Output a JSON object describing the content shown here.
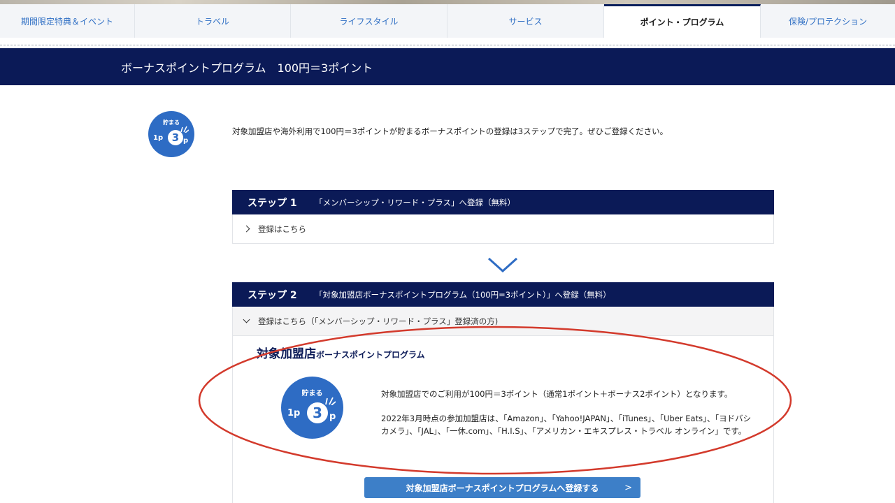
{
  "tabs": [
    {
      "label": "期間限定特典＆イベント",
      "active": false
    },
    {
      "label": "トラベル",
      "active": false
    },
    {
      "label": "ライフスタイル",
      "active": false
    },
    {
      "label": "サービス",
      "active": false
    },
    {
      "label": "ポイント・プログラム",
      "active": true
    },
    {
      "label": "保険/プロテクション",
      "active": false
    }
  ],
  "banner": {
    "title": "ボーナスポイントプログラム　100円＝3ポイント"
  },
  "badge": {
    "top": "貯まる",
    "one": "1p",
    "three": "3",
    "p": "p"
  },
  "intro": "対象加盟店や海外利用で100円＝3ポイントが貯まるボーナスポイントの登録は3ステップで完了。ぜひご登録ください。",
  "step1": {
    "num": "ステップ 1",
    "desc": "「メンバーシップ・リワード・プラス」へ登録（無料）",
    "link": "登録はこちら"
  },
  "step2": {
    "num": "ステップ 2",
    "desc": "「対象加盟店ボーナスポイントプログラム（100円=3ポイント）」へ登録（無料）",
    "link": "登録はこちら（「メンバーシップ・リワード・プラス」登録済の方)"
  },
  "panel": {
    "title_big": "対象加盟店",
    "title_small": "ボーナスポイントプログラム",
    "text1": "対象加盟店でのご利用が100円＝3ポイント（通常1ポイント＋ボーナス2ポイント）となります。",
    "text2": "2022年3月時点の参加加盟店は、「Amazon」、「Yahoo!JAPAN」、「iTunes」、「Uber Eats」、「ヨドバシカメラ」、「JAL」、「一休.com」、「H.I.S」、「アメリカン・エキスプレス・トラベル オンライン」です。",
    "cta": "対象加盟店ボーナスポイントプログラムへ登録する",
    "cta_arrow": ">"
  },
  "colors": {
    "navy": "#0b1a57",
    "blue": "#2e6cc4",
    "annotation": "#d33a2c"
  }
}
